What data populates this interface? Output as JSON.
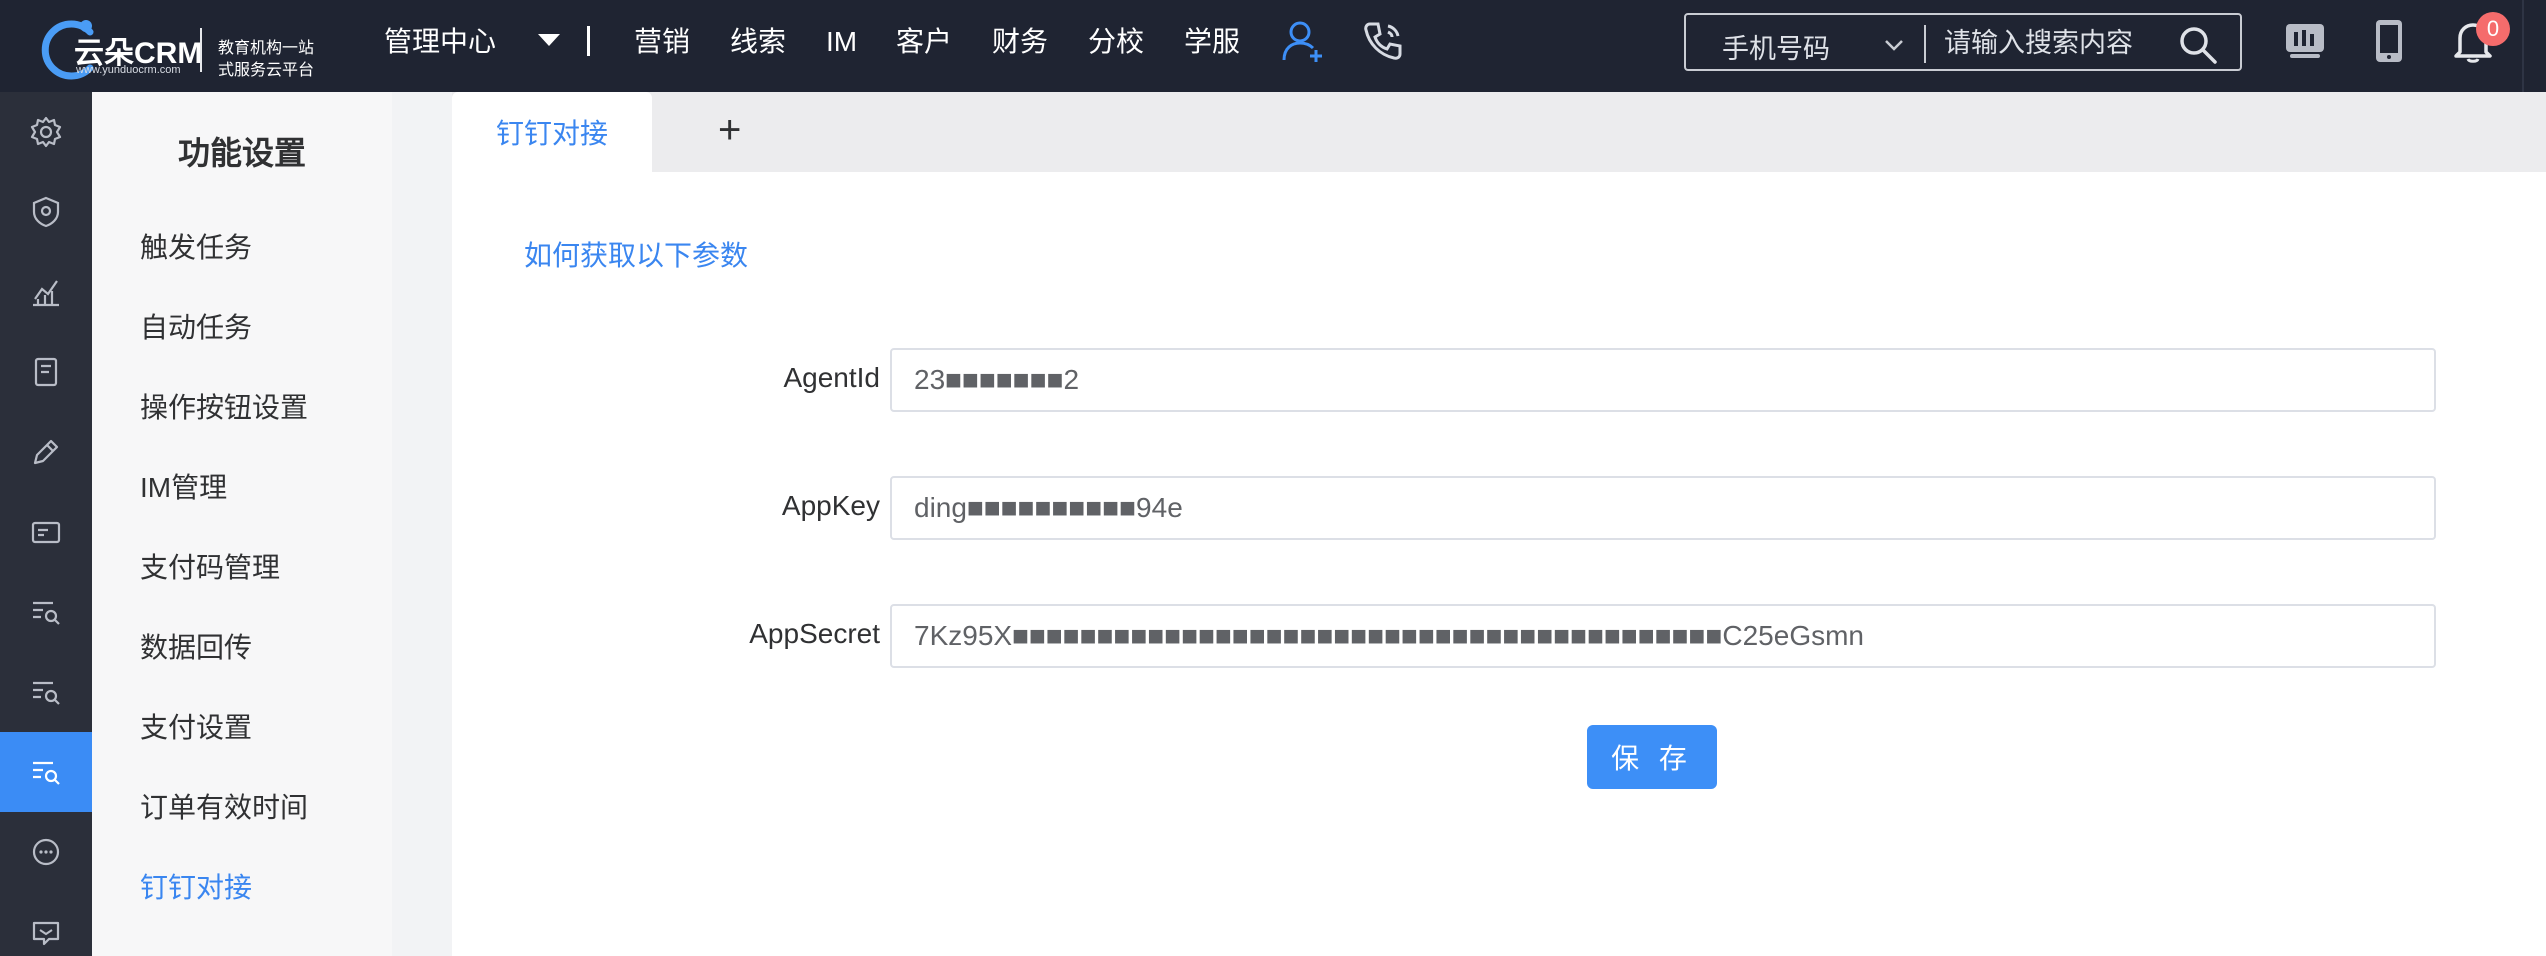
{
  "header": {
    "logo": {
      "word": "云朵CRM",
      "url": "www.yunduocrm.com",
      "slogan_line1": "教育机构一站",
      "slogan_line2": "式服务云平台"
    },
    "admin_menu": "管理中心",
    "nav": [
      "营销",
      "线索",
      "IM",
      "客户",
      "财务",
      "分校",
      "学服"
    ],
    "search": {
      "type": "手机号码",
      "placeholder": "请输入搜索内容"
    },
    "notification_count": "0"
  },
  "sidebar_icons": [
    "gear-icon",
    "shield-icon",
    "chart-icon",
    "document-icon",
    "edit-icon",
    "card-icon",
    "list-search-icon",
    "list-search-icon",
    "list-search-icon",
    "chat-icon",
    "message-icon"
  ],
  "sidebar_active_index": 8,
  "submenu": {
    "title": "功能设置",
    "items": [
      "触发任务",
      "自动任务",
      "操作按钮设置",
      "IM管理",
      "支付码管理",
      "数据回传",
      "支付设置",
      "订单有效时间",
      "钉钉对接"
    ],
    "active_index": 8
  },
  "tabs": {
    "active_label": "钉钉对接",
    "add_label": "+"
  },
  "main": {
    "help_link": "如何获取以下参数",
    "fields": [
      {
        "label": "AgentId",
        "value": "23■■■■■■■2"
      },
      {
        "label": "AppKey",
        "value": "ding■■■■■■■■■■94e"
      },
      {
        "label": "AppSecret",
        "value": "7Kz95X■■■■■■■■■■■■■■■■■■■■■■■■■■■■■■■■■■■■■■■■■■C25eGsmn"
      }
    ],
    "save_label": "保 存"
  },
  "colors": {
    "topbar": "#1f2432",
    "rail": "#2b2f3a",
    "accent": "#3a86f0",
    "badge": "#f56c6c"
  }
}
